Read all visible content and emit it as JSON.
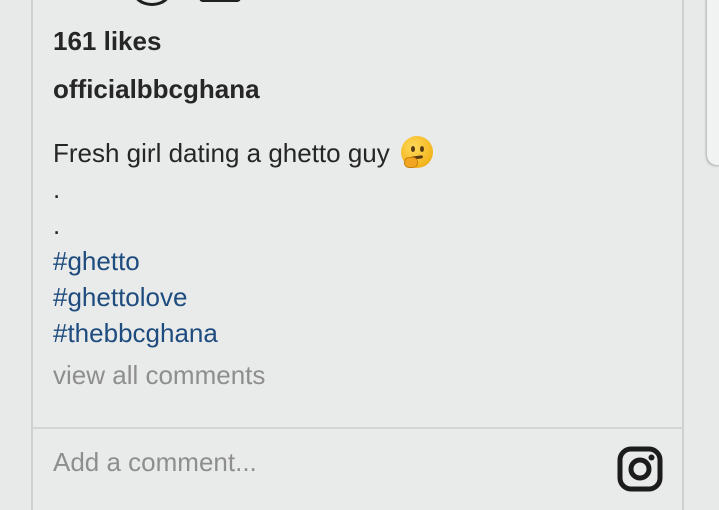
{
  "post": {
    "likes": "161 likes",
    "username": "officialbbcghana",
    "caption_text": "Fresh girl dating a ghetto guy",
    "caption_emoji": "thinking-face-emoji",
    "dots": [
      ".",
      "."
    ],
    "hashtags": [
      "#ghetto",
      "#ghettolove",
      "#thebbcghana"
    ],
    "view_all_comments": "view all comments"
  },
  "comment": {
    "placeholder": "Add a comment..."
  },
  "colors": {
    "background": "#e9eaea",
    "text": "#262626",
    "hashtag": "#1e4c7e",
    "muted": "#8e8e8e"
  }
}
